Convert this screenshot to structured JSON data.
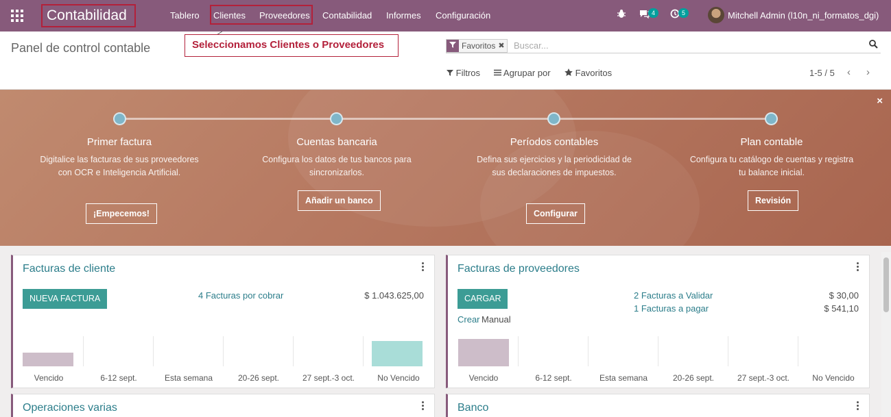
{
  "navbar": {
    "brand": "Contabilidad",
    "menu": [
      "Tablero",
      "Clientes",
      "Proveedores",
      "Contabilidad",
      "Informes",
      "Configuración"
    ],
    "messages_count": "4",
    "activities_count": "5",
    "user": "Mitchell Admin (l10n_ni_formatos_dgi)"
  },
  "control_panel": {
    "title": "Panel de control contable",
    "callout": "Seleccionamos Clientes o Proveedores",
    "facet": "Favoritos",
    "facet_remove": "✖",
    "search_placeholder": "Buscar...",
    "filters": "Filtros",
    "group_by": "Agrupar por",
    "favorites": "Favoritos",
    "pager": "1-5 / 5",
    "pager_prev": "‹",
    "pager_next": "›"
  },
  "banner": {
    "close": "×",
    "steps": [
      {
        "title": "Primer factura",
        "desc": "Digitalice las facturas de sus proveedores con OCR e Inteligencia Artificial.",
        "button": "¡Empecemos!"
      },
      {
        "title": "Cuentas bancaria",
        "desc": "Configura los datos de tus bancos para sincronizarlos.",
        "button": "Añadir un banco"
      },
      {
        "title": "Períodos contables",
        "desc": "Defina sus ejercicios y la periodicidad de sus declaraciones de impuestos.",
        "button": "Configurar"
      },
      {
        "title": "Plan contable",
        "desc": "Configura tu catálogo de cuentas y registra tu balance inicial.",
        "button": "Revisión"
      }
    ]
  },
  "cards": {
    "customer": {
      "title": "Facturas de cliente",
      "button": "NUEVA FACTURA",
      "link": "4 Facturas por cobrar",
      "amount": "$ 1.043.625,00",
      "chart_labels": [
        "Vencido",
        "6-12 sept.",
        "Esta semana",
        "20-26 sept.",
        "27 sept.-3 oct.",
        "No Vencido"
      ]
    },
    "vendor": {
      "title": "Facturas de proveedores",
      "button": "CARGAR",
      "create": "Crear",
      "manual": "Manual",
      "link1": "2 Facturas a Validar",
      "amount1": "$ 30,00",
      "link2": "1 Facturas a pagar",
      "amount2": "$ 541,10",
      "chart_labels": [
        "Vencido",
        "6-12 sept.",
        "Esta semana",
        "20-26 sept.",
        "27 sept.-3 oct.",
        "No Vencido"
      ]
    },
    "misc": {
      "title": "Operaciones varias"
    },
    "bank": {
      "title": "Banco"
    }
  },
  "colors": {
    "primary": "#875a7b",
    "accent": "#3c9c95",
    "link": "#2b7d8a",
    "annotation": "#b3203a"
  }
}
